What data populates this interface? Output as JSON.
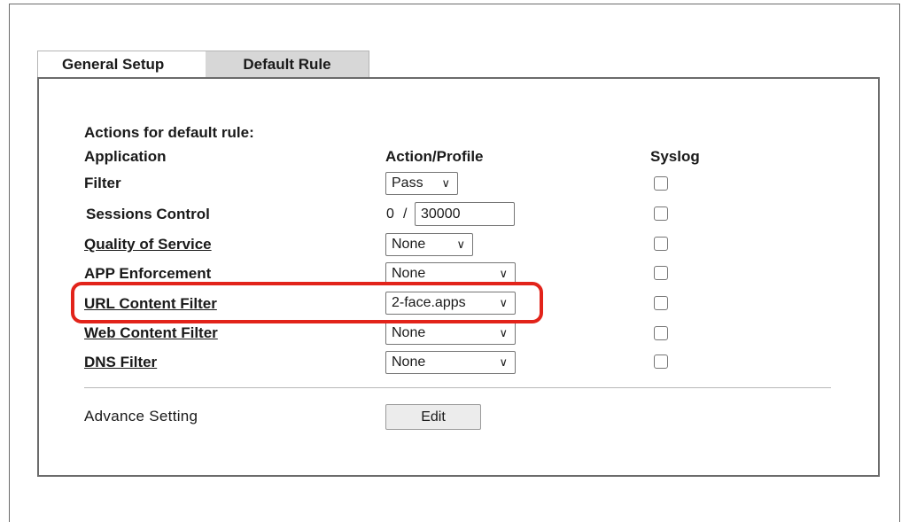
{
  "tabs": [
    {
      "label": "General Setup",
      "active": false
    },
    {
      "label": "Default Rule",
      "active": true
    }
  ],
  "section_title": "Actions for default rule:",
  "headers": {
    "application": "Application",
    "action_profile": "Action/Profile",
    "syslog": "Syslog"
  },
  "rows": {
    "filter": {
      "label": "Filter",
      "value": "Pass",
      "syslog": false
    },
    "sessions_control": {
      "label": "Sessions Control",
      "current": "0",
      "separator": "/",
      "limit": "30000",
      "syslog": false
    },
    "qos": {
      "label": "Quality of Service",
      "value": "None",
      "syslog": false
    },
    "app_enforcement": {
      "label": "APP Enforcement",
      "value": "None",
      "syslog": false
    },
    "url_content_filter": {
      "label": "URL Content Filter",
      "value": "2-face.apps",
      "syslog": false,
      "highlighted": true
    },
    "web_content_filter": {
      "label": "Web Content Filter",
      "value": "None",
      "syslog": false
    },
    "dns_filter": {
      "label": "DNS Filter",
      "value": "None",
      "syslog": false
    }
  },
  "advance_setting": {
    "label": "Advance Setting",
    "button": "Edit"
  },
  "colors": {
    "highlight": "#e2231a",
    "active_tab_bg": "#d7d7d7",
    "border": "#6b6b6b"
  },
  "icons": {
    "dropdown": "chevron-down-icon"
  }
}
